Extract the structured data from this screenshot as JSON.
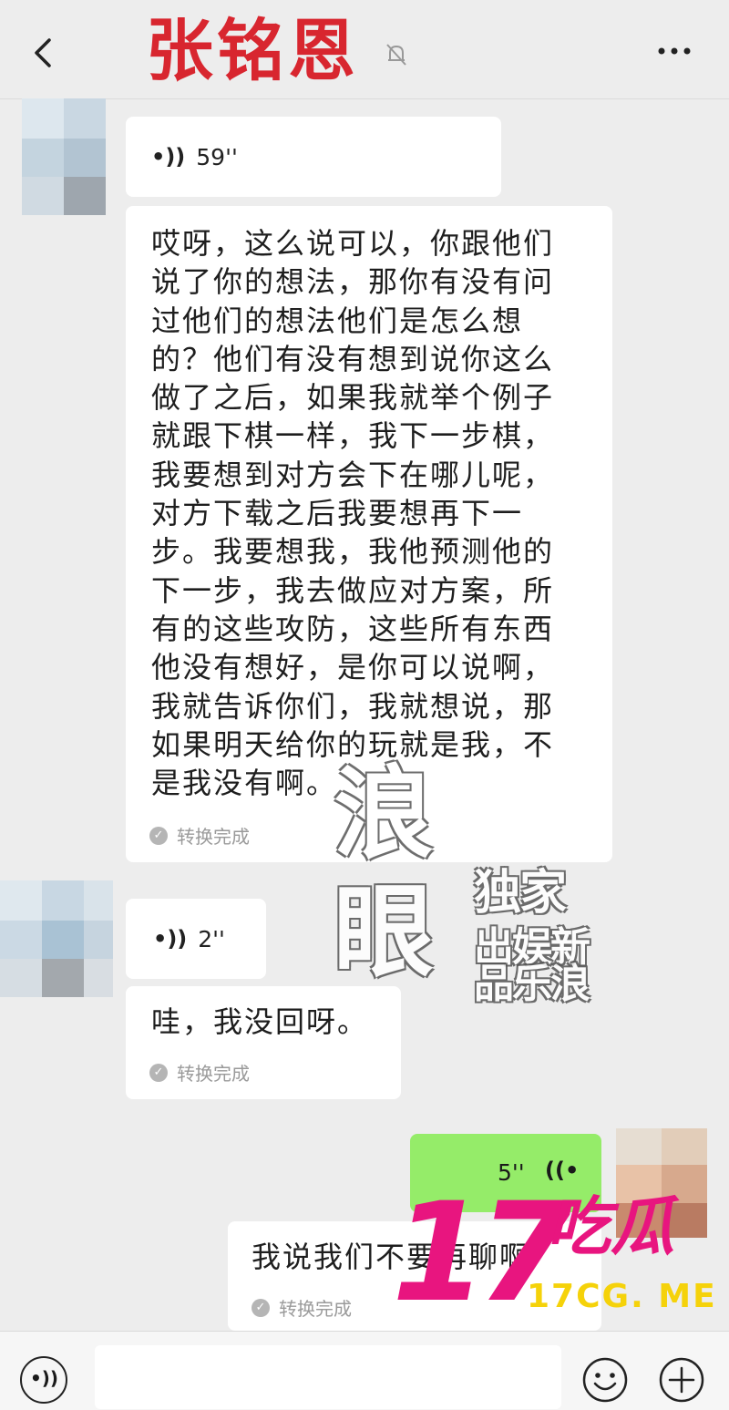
{
  "header": {
    "title": "张铭恩"
  },
  "messages": [
    {
      "voice_duration": "59''"
    },
    {
      "text": "哎呀，这么说可以，你跟他们\n说了你的想法，那你有没有问\n过他们的想法他们是怎么想\n的？他们有没有想到说你这么\n做了之后，如果我就举个例子\n就跟下棋一样，我下一步棋，\n我要想到对方会下在哪儿呢，\n对方下载之后我要想再下一\n步。我要想我，我他预测他的\n下一步，我去做应对方案，所\n有的这些攻防，这些所有东西\n他没有想好，是你可以说啊，\n我就告诉你们，我就想说，那\n如果明天给你的玩就是我，不\n是我没有啊。",
      "status": "转换完成"
    },
    {
      "voice_duration": "2''"
    },
    {
      "text": "哇，我没回呀。",
      "status": "转换完成"
    },
    {
      "voice_duration": "5''"
    },
    {
      "text": "我说我们不要再聊啊",
      "status": "转换完成"
    }
  ],
  "watermark": {
    "big1": "浪",
    "big2": "眼",
    "small1": "独家",
    "small2": "出娱新",
    "small3": "品乐浪"
  },
  "brand": {
    "num": "17",
    "name": "吃瓜",
    "url": "17CG. ME",
    "color": "#e8157f"
  },
  "colors": {
    "title": "#d8262f",
    "green_bubble": "#95ec69",
    "background": "#ededed"
  }
}
